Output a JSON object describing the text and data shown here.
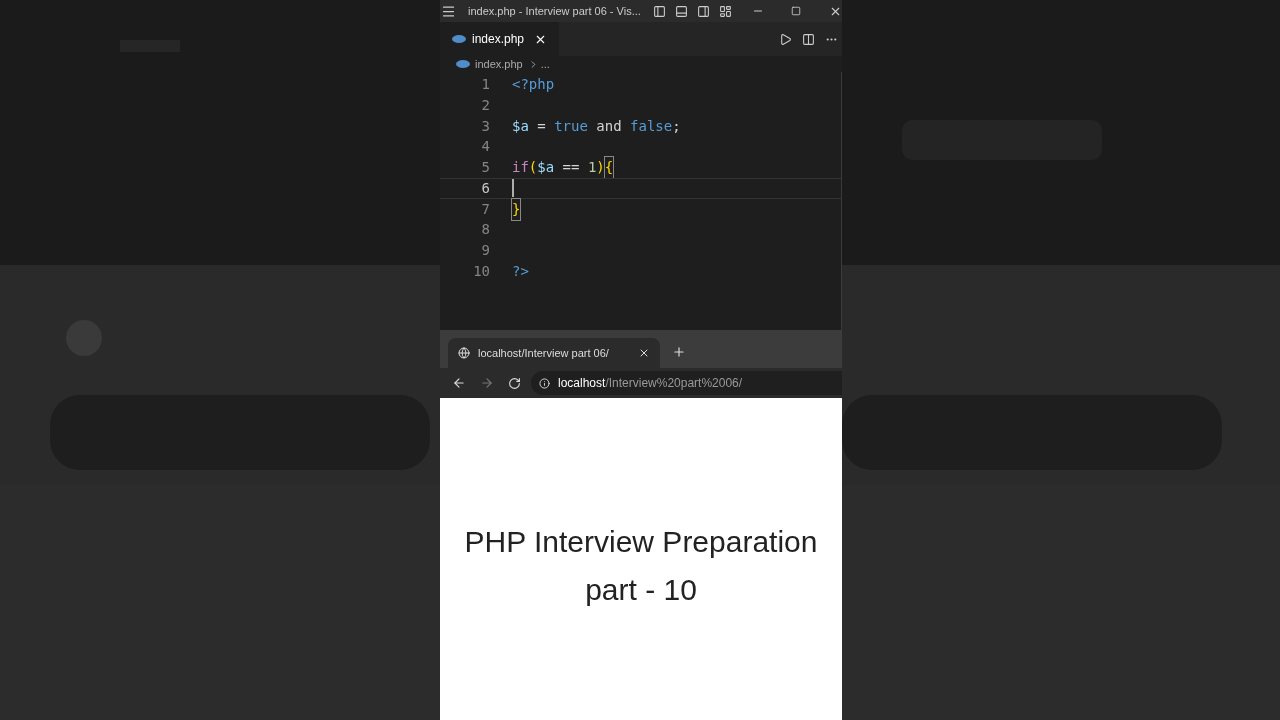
{
  "title_bar": {
    "title": "index.php - Interview part 06 - Vis..."
  },
  "editor_tabs": [
    {
      "label": "index.php",
      "selected": true
    }
  ],
  "breadcrumb": {
    "file": "index.php",
    "rest": "..."
  },
  "code_lines": [
    {
      "number": "1",
      "current": false,
      "tokens": [
        {
          "kind": "tag",
          "text": "<?php"
        }
      ]
    },
    {
      "number": "2",
      "current": false
    },
    {
      "number": "3",
      "current": false,
      "tokens": [
        {
          "kind": "var",
          "text": "$a"
        },
        {
          "kind": "plain",
          "text": " = "
        },
        {
          "kind": "const",
          "text": "true"
        },
        {
          "kind": "plain",
          "text": " and "
        },
        {
          "kind": "const",
          "text": "false"
        },
        {
          "kind": "plain",
          "text": ";"
        }
      ]
    },
    {
      "number": "4",
      "current": false
    },
    {
      "number": "5",
      "current": false,
      "tokens": [
        {
          "kind": "keyword",
          "text": "if"
        },
        {
          "kind": "bracket",
          "text": "("
        },
        {
          "kind": "var",
          "text": "$a"
        },
        {
          "kind": "plain",
          "text": " == "
        },
        {
          "kind": "number",
          "text": "1"
        },
        {
          "kind": "bracket",
          "text": ")"
        },
        {
          "kind": "bracket",
          "text": "{",
          "matched": true
        }
      ]
    },
    {
      "number": "6",
      "current": true
    },
    {
      "number": "7",
      "current": false,
      "tokens": [
        {
          "kind": "bracket",
          "text": "}",
          "matched": true
        }
      ]
    },
    {
      "number": "8",
      "current": false
    },
    {
      "number": "9",
      "current": false
    },
    {
      "number": "10",
      "current": false,
      "tokens": [
        {
          "kind": "tag",
          "text": "?>"
        }
      ]
    }
  ],
  "browser": {
    "tab_title": "localhost/Interview part 06/",
    "forward_disabled": true,
    "url_host": "localhost",
    "url_path": "/Interview%20part%2006/",
    "heading": "PHP Interview Preparation part - 10"
  }
}
